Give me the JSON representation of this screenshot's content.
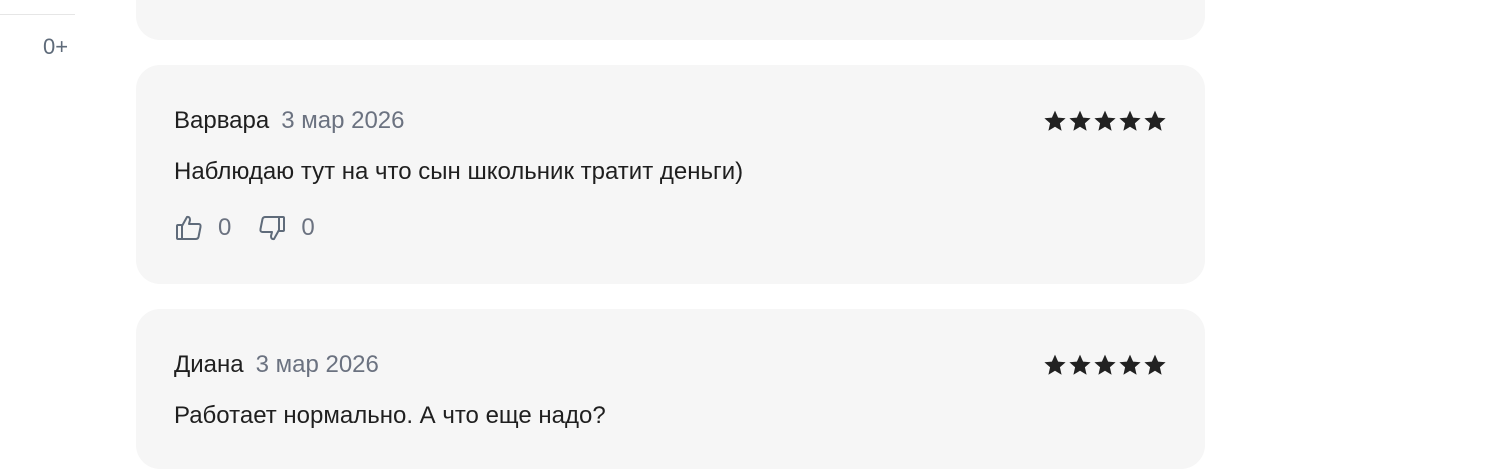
{
  "sidebar": {
    "age_rating": "0+"
  },
  "reviews": [
    {
      "author": "Варвара",
      "date": "3 мар 2026",
      "rating": 5,
      "text": "Наблюдаю тут на что сын школьник тратит деньги)",
      "likes": "0",
      "dislikes": "0"
    },
    {
      "author": "Диана",
      "date": "3 мар 2026",
      "rating": 5,
      "text": "Работает нормально. А что еще надо?"
    }
  ],
  "icons": {
    "star": "star-icon",
    "like": "thumbs-up-icon",
    "dislike": "thumbs-down-icon"
  },
  "colors": {
    "card_background": "#f6f6f6",
    "star": "#222222",
    "muted_text": "#6b7280"
  }
}
